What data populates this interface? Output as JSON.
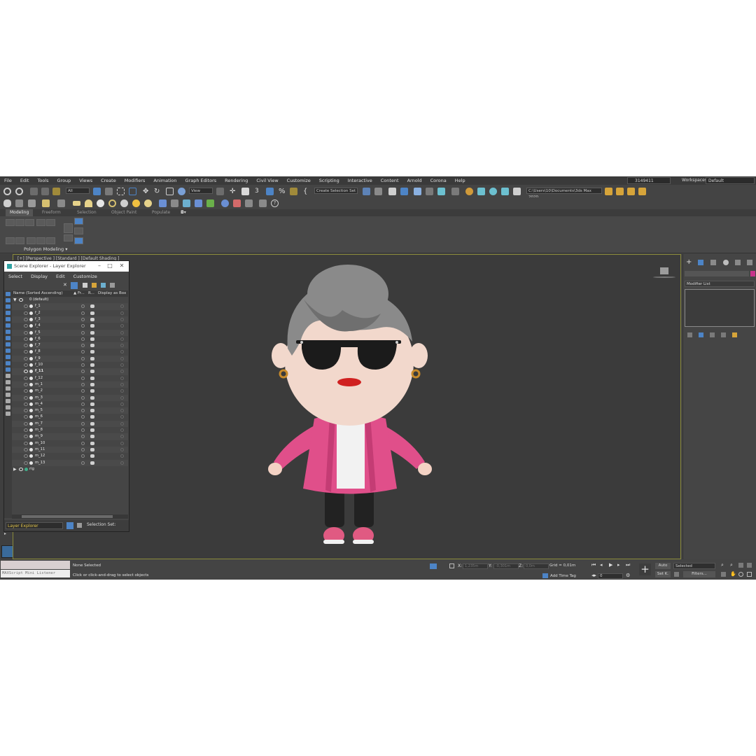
{
  "menubar": {
    "items": [
      "File",
      "Edit",
      "Tools",
      "Group",
      "Views",
      "Create",
      "Modifiers",
      "Animation",
      "Graph Editors",
      "Rendering",
      "Civil View",
      "Customize",
      "Scripting",
      "Interactive",
      "Content",
      "Arnold",
      "Corona",
      "Help"
    ],
    "user": "3149411",
    "workspaces_label": "Workspaces:",
    "workspace_value": "Default"
  },
  "toolbar": {
    "selection_filter": "All",
    "reference_coord": "View",
    "selection_set_placeholder": "Create Selection Set",
    "project_path": "C:\\Users\\10\\Documents\\3ds Max 2020"
  },
  "ribbon": {
    "tabs": [
      "Modeling",
      "Freeform",
      "Selection",
      "Object Paint",
      "Populate"
    ],
    "panel_label": "Polygon Modeling"
  },
  "viewport": {
    "label": "[+] [Perspective ] [Standard ] [Default Shading ]"
  },
  "scene_explorer": {
    "title": "Scene Explorer - Layer Explorer",
    "menus": [
      "Select",
      "Display",
      "Edit",
      "Customize"
    ],
    "columns": {
      "name": "Name (Sorted Ascending)",
      "frozen": "▲ Fr...",
      "render": "R...",
      "display_box": "Display as Box"
    },
    "root_layer": "0 (default)",
    "rows": [
      "f_1",
      "f_2",
      "f_3",
      "f_4",
      "f_5",
      "f_6",
      "f_7",
      "f_8",
      "f_9",
      "f_10",
      "f_11",
      "f_12",
      "m_1",
      "m_2",
      "m_3",
      "m_4",
      "m_5",
      "m_6",
      "m_7",
      "m_8",
      "m_9",
      "m_10",
      "m_11",
      "m_12",
      "m_13"
    ],
    "rig_layer": "rig",
    "footer_mode": "Layer Explorer",
    "selection_set_label": "Selection Set:"
  },
  "command_panel": {
    "modifier_list_label": "Modifier List"
  },
  "statusbar": {
    "maxscript_label": "MAXScript Mini Listener",
    "selection_status": "None Selected",
    "prompt": "Click or click-and-drag to select objects",
    "x_label": "X:",
    "y_label": "Y:",
    "z_label": "Z:",
    "x_value": "1,235m",
    "y_value": "-0,301m",
    "z_value": "0,0m",
    "grid": "Grid = 0,01m",
    "add_time_tag": "Add Time Tag",
    "frame_value": "0",
    "auto_label": "Auto",
    "setk_label": "Set K.",
    "key_filter": "Selected",
    "filters_label": "Filters..."
  },
  "colors": {
    "accent": "#4d84c6",
    "jacket": "#e04f8a",
    "hair": "#8a8a8a",
    "viewport_bg": "#3b3b3b"
  }
}
